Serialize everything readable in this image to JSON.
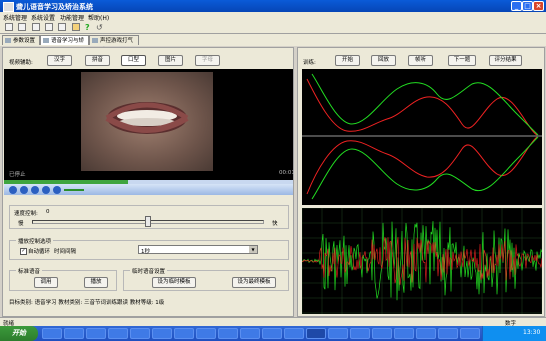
{
  "window": {
    "title": "聋儿语音学习及矫治系统"
  },
  "menu": [
    "系统管理",
    "系统设置",
    "功能管理",
    "帮助(H)"
  ],
  "tabs": [
    {
      "label": "参数设置",
      "active": false
    },
    {
      "label": "语音学习与矫治",
      "active": true
    },
    {
      "label": "声控游戏打气球",
      "active": false
    }
  ],
  "video_aid": {
    "label": "视频辅助:",
    "buttons": [
      "汉字",
      "拼音",
      "口型",
      "图片",
      "字母"
    ],
    "selected": "口型"
  },
  "player": {
    "status": "已停止",
    "time": "00:01",
    "progress": 0.43
  },
  "speed": {
    "label": "速度控制:",
    "value": "0",
    "slow": "慢",
    "fast": "快",
    "position": 0.5
  },
  "playback": {
    "title": "播放控制选项",
    "auto_loop": "自动循环",
    "auto_loop_checked": true,
    "interval_label": "时间间隔",
    "interval_value": "1秒"
  },
  "standard": {
    "title": "标准语音",
    "buttons": [
      "调用",
      "播放"
    ]
  },
  "temp": {
    "title": "临时语音设置",
    "buttons": [
      "设为临时模板",
      "设为最终模板"
    ]
  },
  "target_info": "目标类别: 语音学习    教材类别: 三音节词训练跟读    教材等级: 1级",
  "training": {
    "label": "训练:",
    "buttons": [
      "开始",
      "回放",
      "帧听",
      "下一题",
      "评分结果"
    ]
  },
  "status": {
    "left": "就绪",
    "right": "数字"
  },
  "taskbar": {
    "start": "开始",
    "clock": "13:30"
  },
  "colors": {
    "title": "#0a5bd8",
    "wave_green": "#22dd22",
    "wave_red": "#ee2222"
  }
}
